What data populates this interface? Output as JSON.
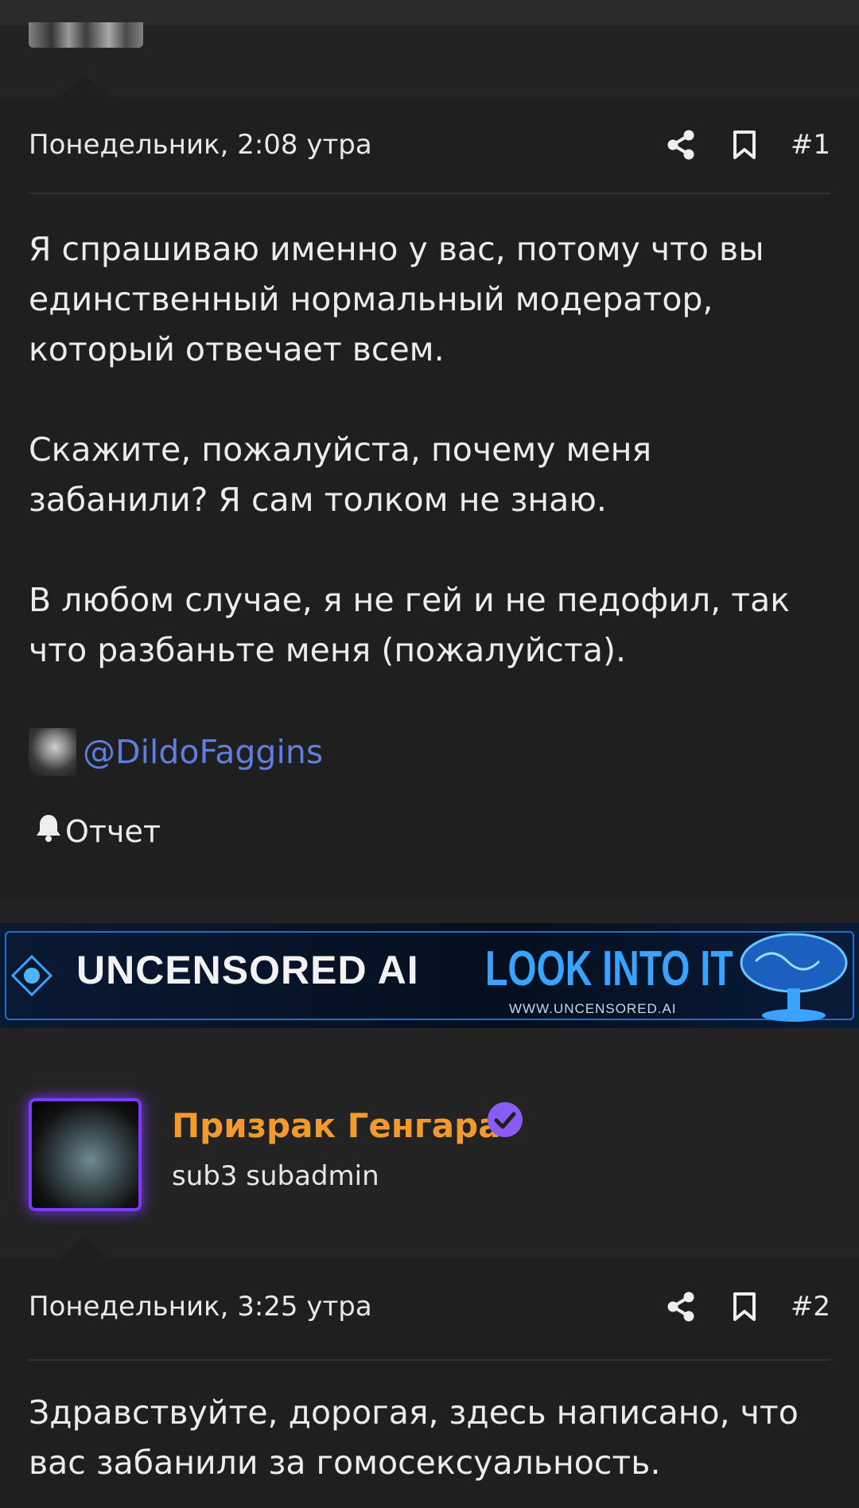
{
  "post1": {
    "date": "Понедельник, 2:08 утра",
    "number": "#1",
    "paragraphs": [
      "Я спрашиваю именно у вас, потому что вы единственный нормальный модератор, который отвечает всем.",
      "Скажите, пожалуйста, почему меня забанили? Я сам толком не знаю.",
      "В любом случае, я не гей и не педофил, так что разбаньте меня (пожалуйста)."
    ],
    "mention": "@DildoFaggins",
    "report_label": "Отчет"
  },
  "banner": {
    "title": "UNCENSORED AI",
    "cta": "LOOK INTO IT",
    "url": "WWW.UNCENSORED.AI"
  },
  "author": {
    "name": "Призрак Генгара",
    "role": "sub3 subadmin"
  },
  "post2": {
    "date": "Понедельник, 3:25 утра",
    "number": "#2",
    "paragraphs": [
      "Здравствуйте, дорогая, здесь написано, что вас забанили за гомосексуальность."
    ]
  },
  "colors": {
    "accent_link": "#5f7ee0",
    "author_name": "#f39a2c",
    "badge": "#8a5cf6",
    "avatar_border": "#7a3bf2"
  }
}
